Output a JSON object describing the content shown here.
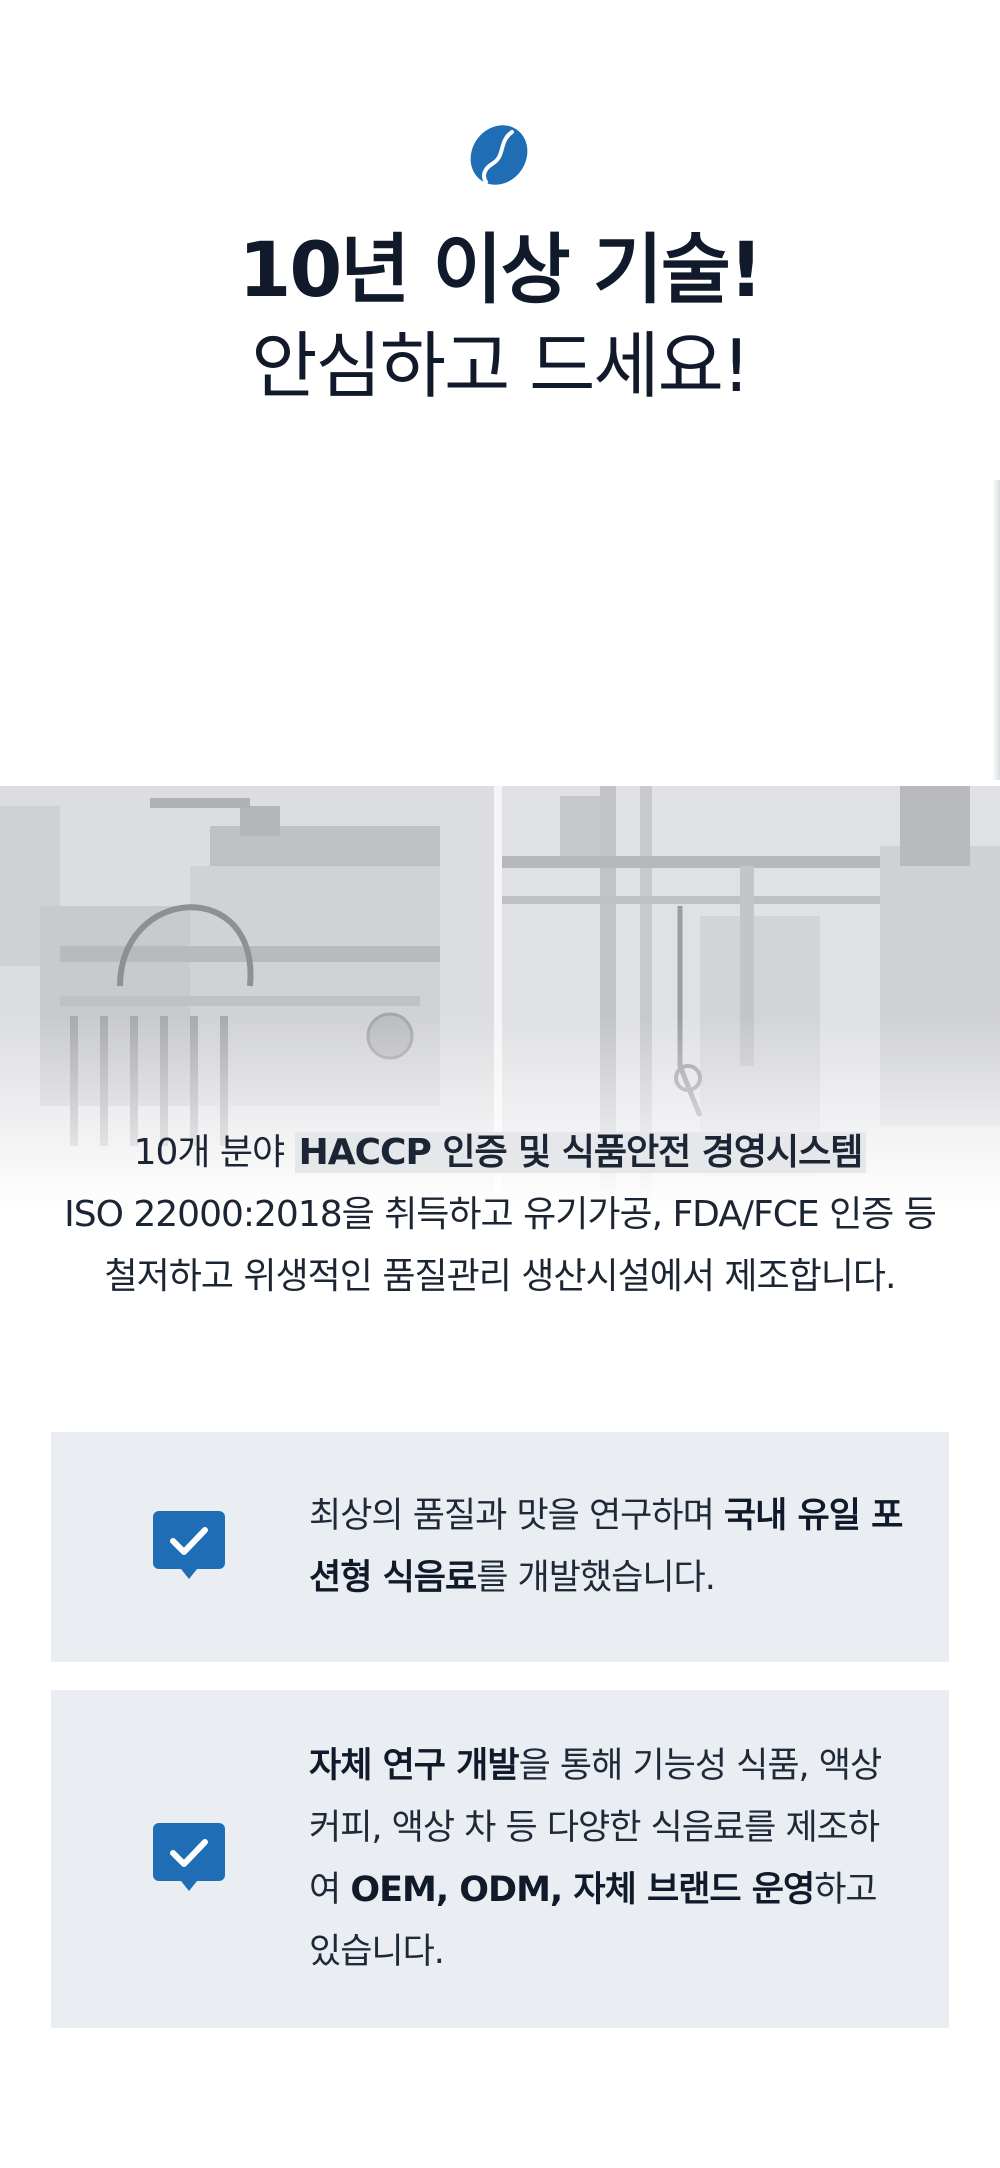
{
  "header": {
    "logo_icon": "coffee-bean-icon",
    "title_line1": "10년 이상 기술!",
    "title_line2": "안심하고 드세요!"
  },
  "facility_image": {
    "description_icon": "factory-equipment-image"
  },
  "intro": {
    "text_1": "10개 분야 ",
    "highlight": "HACCP 인증 및 식품안전 경영시스템",
    "text_2": "ISO 22000:2018을 취득하고 유기가공, FDA/FCE 인증 등 철저하고 위생적인 품질관리 생산시설에서 제조합니다."
  },
  "features": [
    {
      "icon": "checkmark-badge-icon",
      "text_1": "최상의 품질과 맛을 연구하며 ",
      "bold_1": "국내 유일 포션형 식음료",
      "text_2": "를 개발했습니다."
    },
    {
      "icon": "checkmark-badge-icon",
      "bold_1": "자체 연구 개발",
      "text_1": "을 통해 기능성 식품, 액상 커피, 액상 차 등 다양한 식음료를 제조하여 ",
      "bold_2": "OEM, ODM, 자체 브랜드 운영",
      "text_2": "하고 있습니다."
    }
  ],
  "colors": {
    "brand_blue": "#1f6db5",
    "card_bg": "#eaeef2",
    "text_dark": "#111a2a"
  }
}
